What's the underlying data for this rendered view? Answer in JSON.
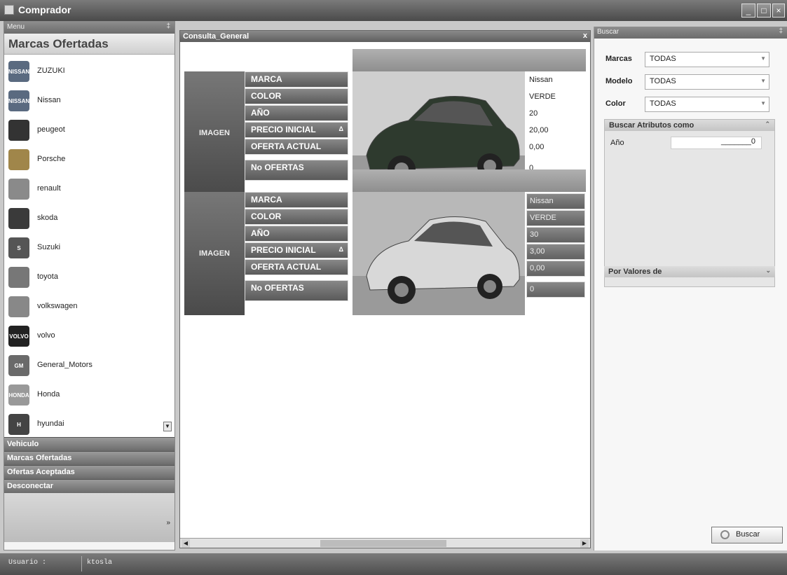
{
  "window": {
    "title": "Comprador"
  },
  "menu": {
    "header": "Menu",
    "pin": "‡",
    "section_title": "Marcas Ofertadas",
    "brands": [
      {
        "label": "ZUZUKI",
        "logo": "nissan-logo",
        "color": "#5a6a80",
        "badge": "NISSAN"
      },
      {
        "label": "Nissan",
        "logo": "nissan-logo",
        "color": "#5a6a80",
        "badge": "NISSAN"
      },
      {
        "label": "peugeot",
        "logo": "peugeot-logo",
        "color": "#333333",
        "badge": ""
      },
      {
        "label": "Porsche",
        "logo": "porsche-logo",
        "color": "#a0864a",
        "badge": ""
      },
      {
        "label": "renault",
        "logo": "renault-logo",
        "color": "#8a8a8a",
        "badge": ""
      },
      {
        "label": "skoda",
        "logo": "skoda-logo",
        "color": "#3a3a3a",
        "badge": ""
      },
      {
        "label": "Suzuki",
        "logo": "suzuki-logo",
        "color": "#555555",
        "badge": "S"
      },
      {
        "label": "toyota",
        "logo": "toyota-logo",
        "color": "#777777",
        "badge": ""
      },
      {
        "label": "volkswagen",
        "logo": "volkswagen-logo",
        "color": "#888888",
        "badge": ""
      },
      {
        "label": "volvo",
        "logo": "volvo-logo",
        "color": "#222222",
        "badge": "VOLVO"
      },
      {
        "label": "General_Motors",
        "logo": "general-motors-logo",
        "color": "#6a6a6a",
        "badge": "GM"
      },
      {
        "label": "Honda",
        "logo": "honda-logo",
        "color": "#999999",
        "badge": "HONDA"
      },
      {
        "label": "hyundai",
        "logo": "hyundai-logo",
        "color": "#444444",
        "badge": "H"
      }
    ],
    "nav": [
      "Vehiculo",
      "Marcas Ofertadas",
      "Ofertas Aceptadas",
      "Desconectar"
    ]
  },
  "doc": {
    "title": "Consulta_General",
    "close": "x",
    "cards": [
      {
        "imagen": "IMAGEN",
        "labels": [
          "MARCA",
          "COLOR",
          "AÑO",
          "PRECIO INICIAL",
          "OFERTA ACTUAL",
          "No OFERTAS"
        ],
        "values": [
          "Nissan",
          "VERDE",
          "20",
          "20,00",
          "0,00",
          "0"
        ]
      },
      {
        "imagen": "IMAGEN",
        "labels": [
          "MARCA",
          "COLOR",
          "AÑO",
          "PRECIO INICIAL",
          "OFERTA ACTUAL",
          "No OFERTAS"
        ],
        "values": [
          "Nissan",
          "VERDE",
          "30",
          "3,00",
          "0,00",
          "0"
        ]
      }
    ],
    "sort_glyph": "Δ"
  },
  "search": {
    "header": "Buscar",
    "fields": [
      {
        "label": "Marcas",
        "value": "TODAS"
      },
      {
        "label": "Modelo",
        "value": "TODAS"
      },
      {
        "label": "Color",
        "value": "TODAS"
      }
    ],
    "attr_group": "Buscar Atributos como",
    "anio_label": "Año",
    "anio_value": "_______0",
    "values_group": "Por Valores de",
    "button": "Buscar"
  },
  "status": {
    "user_label": "Usuario :",
    "user_value": "ktosla"
  }
}
